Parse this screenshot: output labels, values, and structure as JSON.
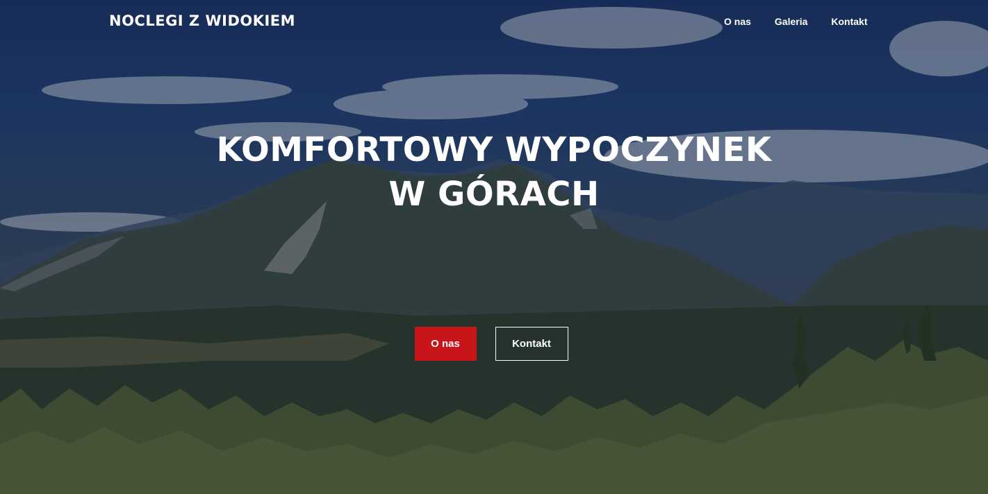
{
  "brand": {
    "name": "NOCLEGI Z WIDOKIEM"
  },
  "nav": {
    "items": [
      {
        "label": "O nas"
      },
      {
        "label": "Galeria"
      },
      {
        "label": "Kontakt"
      }
    ]
  },
  "hero": {
    "headline_line1": "KOMFORTOWY WYPOCZYNEK",
    "headline_line2": "W GÓRACH",
    "background_image": "mountain-landscape"
  },
  "cta": {
    "primary_label": "O nas",
    "secondary_label": "Kontakt"
  },
  "colors": {
    "accent": "#c8151a",
    "text": "#ffffff",
    "sky": "#1c3464",
    "forest": "#3a4a30"
  }
}
